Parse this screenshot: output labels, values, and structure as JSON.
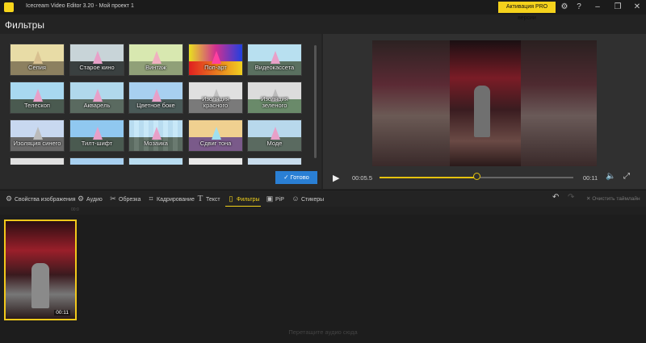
{
  "window": {
    "title": "Icecream Video Editor 3.20  -  Мой проект 1",
    "pro_button": "Активация PRO версии"
  },
  "filters": {
    "heading": "Фильтры",
    "items": [
      {
        "label": "Сепия"
      },
      {
        "label": "Старое кино"
      },
      {
        "label": "Винтаж"
      },
      {
        "label": "Поп-арт"
      },
      {
        "label": "Видеокассета"
      },
      {
        "label": "Телескоп"
      },
      {
        "label": "Акварель"
      },
      {
        "label": "Цветное боке"
      },
      {
        "label": "Изоляция красного"
      },
      {
        "label": "Изоляция зеленого"
      },
      {
        "label": "Изоляция синего"
      },
      {
        "label": "Тилт-шифт"
      },
      {
        "label": "Мозаика"
      },
      {
        "label": "Сдвиг тона"
      },
      {
        "label": "Моде"
      },
      {
        "label": ""
      },
      {
        "label": ""
      },
      {
        "label": ""
      },
      {
        "label": ""
      },
      {
        "label": ""
      }
    ],
    "done_button": "Готово"
  },
  "player": {
    "current_time": "00:05.5",
    "total_time": "00:11",
    "progress": 0.5
  },
  "toolbar": {
    "items": [
      {
        "label": "Свойства изображения",
        "icon": "gear-icon"
      },
      {
        "label": "Аудио",
        "icon": "audio-icon"
      },
      {
        "label": "Обрезка",
        "icon": "scissors-icon"
      },
      {
        "label": "Кадрирование",
        "icon": "crop-icon"
      },
      {
        "label": "Текст",
        "icon": "text-icon"
      },
      {
        "label": "Фильтры",
        "icon": "filter-icon"
      },
      {
        "label": "PiP",
        "icon": "pip-icon"
      },
      {
        "label": "Стикеры",
        "icon": "sticker-icon"
      }
    ],
    "clear_timeline": "Очистить таймлайн"
  },
  "timeline": {
    "ruler_label": "00:0",
    "clip_duration": "00:11",
    "audio_hint": "Перетащите аудио сюда"
  }
}
